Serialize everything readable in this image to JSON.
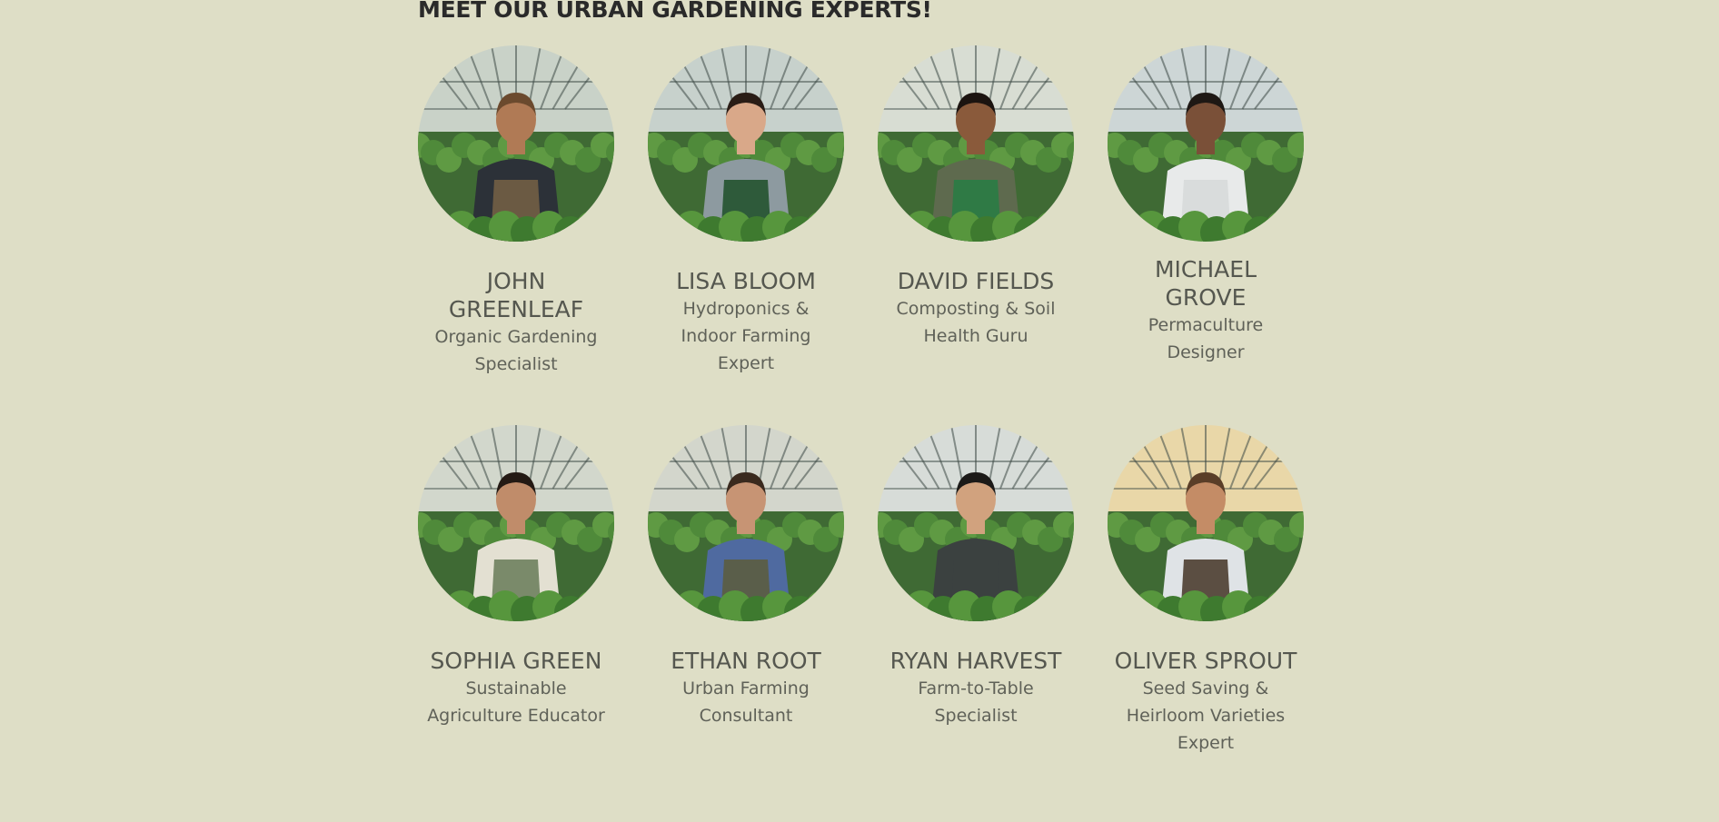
{
  "section": {
    "title": "MEET OUR URBAN GARDENING EXPERTS!"
  },
  "experts": [
    {
      "name": "JOHN GREENLEAF",
      "role": "Organic Gardening Specialist",
      "photo_icon": "greenhouse-person-icon",
      "colors": {
        "sky": "#c9d2c8",
        "shirt": "#2c3138",
        "apron": "#6b5a43",
        "skin": "#b07a55",
        "hair": "#6b4a2e"
      }
    },
    {
      "name": "LISA BLOOM",
      "role": "Hydroponics & Indoor Farming Expert",
      "photo_icon": "greenhouse-person-icon",
      "colors": {
        "sky": "#c7d1cc",
        "shirt": "#8d9aa0",
        "apron": "#2e5a3a",
        "skin": "#d9a889",
        "hair": "#2a1d16"
      }
    },
    {
      "name": "DAVID FIELDS",
      "role": "Composting & Soil Health Guru",
      "photo_icon": "greenhouse-person-icon",
      "colors": {
        "sky": "#d8ddd3",
        "shirt": "#5e6a4e",
        "apron": "#2f7a45",
        "skin": "#8a5a3b",
        "hair": "#1c1410"
      }
    },
    {
      "name": "MICHAEL GROVE",
      "role": "Permaculture Designer",
      "photo_icon": "greenhouse-person-icon",
      "colors": {
        "sky": "#cdd6d6",
        "shirt": "#e8eaea",
        "apron": "#d9dcdc",
        "skin": "#7a5038",
        "hair": "#1e1814"
      }
    },
    {
      "name": "SOPHIA GREEN",
      "role": "Sustainable Agriculture Educator",
      "photo_icon": "greenhouse-person-icon",
      "colors": {
        "sky": "#d2d7cc",
        "shirt": "#e3e0d2",
        "apron": "#7a8a6a",
        "skin": "#c08c6a",
        "hair": "#241a14"
      }
    },
    {
      "name": "ETHAN ROOT",
      "role": "Urban Farming Consultant",
      "photo_icon": "greenhouse-person-icon",
      "colors": {
        "sky": "#d3d6cc",
        "shirt": "#4f6aa0",
        "apron": "#5a5e4a",
        "skin": "#c79474",
        "hair": "#3a2a1e"
      }
    },
    {
      "name": "RYAN HARVEST",
      "role": "Farm-to-Table Specialist",
      "photo_icon": "greenhouse-person-icon",
      "colors": {
        "sky": "#d7dcd8",
        "shirt": "#3b4140",
        "apron": "#3b4140",
        "skin": "#d1a27e",
        "hair": "#1c1a18"
      }
    },
    {
      "name": "OLIVER SPROUT",
      "role": "Seed Saving & Heirloom Varieties Expert",
      "photo_icon": "greenhouse-person-icon",
      "colors": {
        "sky": "#e9d7a8",
        "shirt": "#dfe3e6",
        "apron": "#5b4e42",
        "skin": "#c48c66",
        "hair": "#5a3e28"
      }
    }
  ]
}
